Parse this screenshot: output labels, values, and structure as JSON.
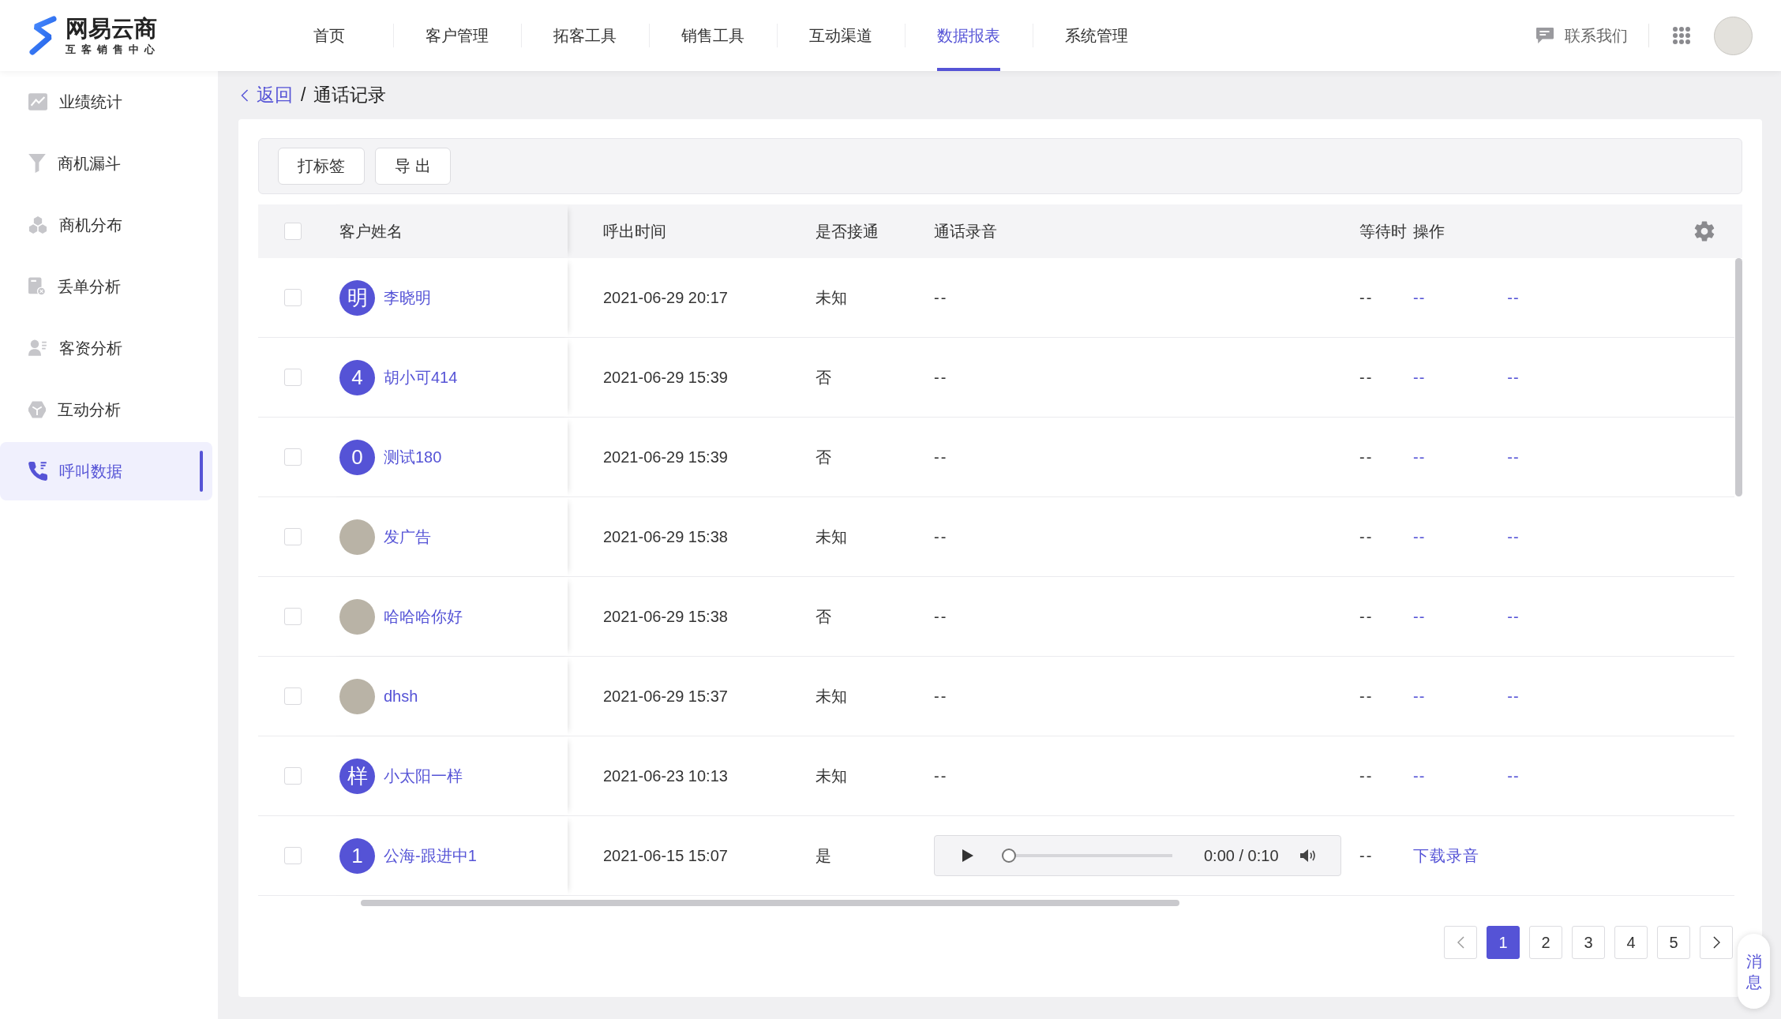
{
  "header": {
    "logo": {
      "title": "网易云商",
      "subtitle": "互客销售中心"
    },
    "nav": [
      {
        "label": "首页",
        "selected": false
      },
      {
        "label": "客户管理",
        "selected": false
      },
      {
        "label": "拓客工具",
        "selected": false
      },
      {
        "label": "销售工具",
        "selected": false
      },
      {
        "label": "互动渠道",
        "selected": false
      },
      {
        "label": "数据报表",
        "selected": true
      },
      {
        "label": "系统管理",
        "selected": false
      }
    ],
    "contact": "联系我们"
  },
  "sidebar": {
    "items": [
      {
        "label": "业绩统计",
        "selected": false
      },
      {
        "label": "商机漏斗",
        "selected": false
      },
      {
        "label": "商机分布",
        "selected": false
      },
      {
        "label": "丢单分析",
        "selected": false
      },
      {
        "label": "客资分析",
        "selected": false
      },
      {
        "label": "互动分析",
        "selected": false
      },
      {
        "label": "呼叫数据",
        "selected": true
      }
    ]
  },
  "breadcrumb": {
    "back": "返回",
    "separator": "/",
    "current": "通话记录"
  },
  "toolbar": {
    "buttons": [
      "打标签",
      "导 出"
    ]
  },
  "table": {
    "header_checked": false,
    "columns": [
      "客户姓名",
      "呼出时间",
      "是否接通",
      "通话录音",
      "等待时",
      "操作"
    ],
    "rows": [
      {
        "checked": false,
        "avatar": {
          "kind": "letter",
          "text": "明"
        },
        "name": "李晓明",
        "call_time": "2021-06-29 20:17",
        "connected": "未知",
        "recording": {
          "kind": "text",
          "text": "--"
        },
        "wait": "--",
        "actions": [
          "--",
          "--"
        ]
      },
      {
        "checked": false,
        "avatar": {
          "kind": "letter",
          "text": "4"
        },
        "name": "胡小可414",
        "call_time": "2021-06-29 15:39",
        "connected": "否",
        "recording": {
          "kind": "text",
          "text": "--"
        },
        "wait": "--",
        "actions": [
          "--",
          "--"
        ]
      },
      {
        "checked": false,
        "avatar": {
          "kind": "letter",
          "text": "0"
        },
        "name": "测试180",
        "call_time": "2021-06-29 15:39",
        "connected": "否",
        "recording": {
          "kind": "text",
          "text": "--"
        },
        "wait": "--",
        "actions": [
          "--",
          "--"
        ]
      },
      {
        "checked": false,
        "avatar": {
          "kind": "photo"
        },
        "name": "发广告",
        "call_time": "2021-06-29 15:38",
        "connected": "未知",
        "recording": {
          "kind": "text",
          "text": "--"
        },
        "wait": "--",
        "actions": [
          "--",
          "--"
        ]
      },
      {
        "checked": false,
        "avatar": {
          "kind": "photo"
        },
        "name": "哈哈哈你好",
        "call_time": "2021-06-29 15:38",
        "connected": "否",
        "recording": {
          "kind": "text",
          "text": "--"
        },
        "wait": "--",
        "actions": [
          "--",
          "--"
        ]
      },
      {
        "checked": false,
        "avatar": {
          "kind": "photo"
        },
        "name": "dhsh",
        "call_time": "2021-06-29 15:37",
        "connected": "未知",
        "recording": {
          "kind": "text",
          "text": "--"
        },
        "wait": "--",
        "actions": [
          "--",
          "--"
        ]
      },
      {
        "checked": false,
        "avatar": {
          "kind": "letter",
          "text": "样"
        },
        "name": "小太阳一样",
        "call_time": "2021-06-23 10:13",
        "connected": "未知",
        "recording": {
          "kind": "text",
          "text": "--"
        },
        "wait": "--",
        "actions": [
          "--",
          "--"
        ]
      },
      {
        "checked": false,
        "avatar": {
          "kind": "letter",
          "text": "1"
        },
        "name": "公海-跟进中1",
        "call_time": "2021-06-15 15:07",
        "connected": "是",
        "recording": {
          "kind": "player",
          "time": "0:00 / 0:10",
          "level": 0
        },
        "wait": "--",
        "actions": [
          "下载录音"
        ]
      }
    ]
  },
  "pagination": {
    "pages": [
      {
        "label": "1",
        "selected": true
      },
      {
        "label": "2",
        "selected": false
      },
      {
        "label": "3",
        "selected": false
      },
      {
        "label": "4",
        "selected": false
      },
      {
        "label": "5",
        "selected": false
      }
    ]
  },
  "message_button": "消息"
}
